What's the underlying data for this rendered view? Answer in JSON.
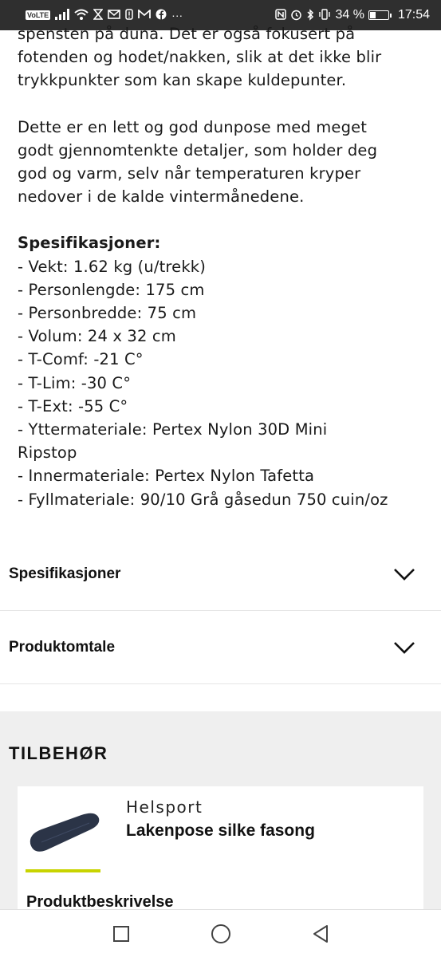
{
  "status_bar": {
    "volte": "VoLTE",
    "battery_percent": "34 %",
    "battery_level": 0.34,
    "time": "17:54",
    "left_icons": [
      "signal-icon",
      "wifi-icon",
      "hourglass-icon",
      "mail-icon",
      "alert-icon",
      "gmail-icon",
      "facebook-icon",
      "more-icon"
    ],
    "more": "···"
  },
  "description": {
    "para1_lines": [
      "spensten på duna. Det er også fokusert på",
      "fotenden og hodet/nakken, slik at det ikke blir",
      "trykkpunkter som kan skape kuldepunter."
    ],
    "para2_lines": [
      "Dette er en lett og god dunpose med meget",
      "godt gjennomtenkte detaljer, som holder deg",
      "god og varm, selv når temperaturen kryper",
      "nedover i de kalde vintermånedene."
    ],
    "spec_title": "Spesifikasjoner:",
    "spec_lines": [
      "- Vekt: 1.62 kg (u/trekk)",
      "- Personlengde: 175 cm",
      "- Personbredde: 75 cm",
      "- Volum: 24 x 32 cm",
      "- T-Comf: -21 C°",
      "- T-Lim: -30 C°",
      "- T-Ext: -55 C°",
      "- Yttermateriale: Pertex Nylon 30D Mini",
      "Ripstop",
      "- Innermateriale: Pertex Nylon Tafetta",
      "- Fyllmateriale: 90/10 Grå gåsedun 750 cuin/oz"
    ]
  },
  "accordions": [
    {
      "label": "Spesifikasjoner"
    },
    {
      "label": "Produktomtale"
    }
  ],
  "accessories": {
    "title": "TILBEHØR",
    "accent_color": "#c8d400",
    "item": {
      "brand": "Helsport",
      "name": "Lakenpose silke fasong",
      "description_label": "Produktbeskrivelse"
    }
  }
}
